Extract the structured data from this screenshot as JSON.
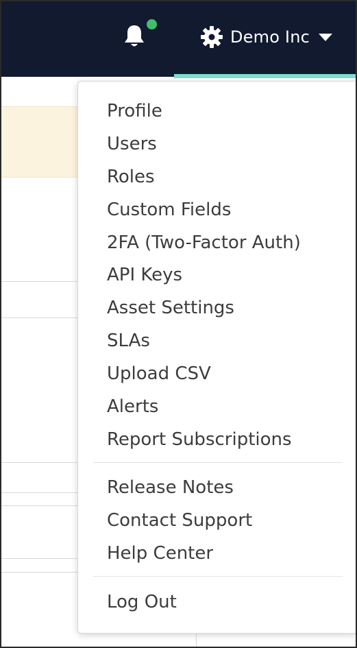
{
  "header": {
    "account_name": "Demo Inc",
    "notification_dot_color": "#3fbf6b",
    "icons": [
      "bell-icon",
      "gear-icon",
      "caret-down-icon"
    ]
  },
  "menu": {
    "group1": [
      {
        "label": "Profile"
      },
      {
        "label": "Users"
      },
      {
        "label": "Roles"
      },
      {
        "label": "Custom Fields"
      },
      {
        "label": "2FA (Two-Factor Auth)"
      },
      {
        "label": "API Keys"
      },
      {
        "label": "Asset Settings"
      },
      {
        "label": "SLAs"
      },
      {
        "label": "Upload CSV"
      },
      {
        "label": "Alerts"
      },
      {
        "label": "Report Subscriptions"
      }
    ],
    "group2": [
      {
        "label": "Release Notes"
      },
      {
        "label": "Contact Support"
      },
      {
        "label": "Help Center"
      }
    ],
    "group3": [
      {
        "label": "Log Out"
      }
    ]
  },
  "colors": {
    "topbar": "#111a2e",
    "accent_underline": "#7fdcd6",
    "banner": "#fcf3df",
    "menu_text": "#3c3c3c"
  }
}
